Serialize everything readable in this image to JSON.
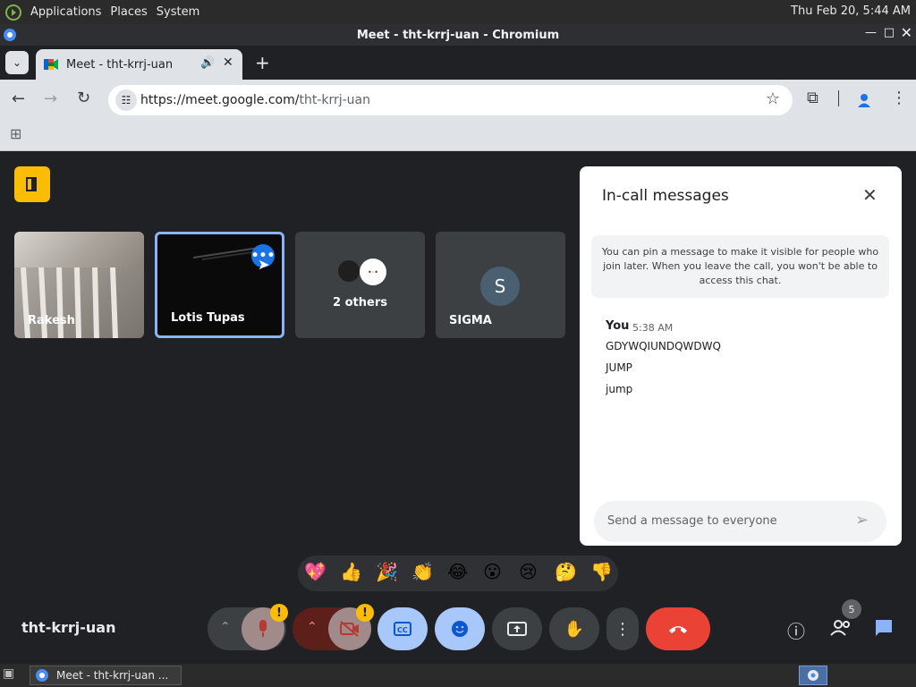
{
  "system_panel": {
    "menus": [
      "Applications",
      "Places",
      "System"
    ],
    "clock": "Thu Feb 20,  5:44 AM"
  },
  "window": {
    "title": "Meet - tht-krrj-uan - Chromium"
  },
  "tab": {
    "title": "Meet - tht-krrj-uan"
  },
  "toolbar": {
    "url_host": "https://meet.google.com/",
    "url_path": "tht-krrj-uan"
  },
  "meet": {
    "meeting_code": "tht-krrj-uan",
    "participants": [
      {
        "name": "Rakesh"
      },
      {
        "name": "Lotis Tupas"
      },
      {
        "name": "2 others"
      },
      {
        "name": "SIGMA",
        "initial": "S"
      }
    ],
    "people_count": "5",
    "reactions": [
      "💖",
      "👍",
      "🎉",
      "👏",
      "😂",
      "😮",
      "😢",
      "🤔",
      "👎"
    ],
    "alert_glyph": "!"
  },
  "chat": {
    "title": "In-call messages",
    "info": "You can pin a message to make it visible for people who join later. When you leave the call, you won't be able to access this chat.",
    "sender": "You",
    "time": "5:38 AM",
    "messages": [
      "GDYWQIUNDQWDWQ",
      "JUMP",
      "jump"
    ],
    "input_placeholder": "Send a message to everyone"
  },
  "taskbar": {
    "window_label": "Meet - tht-krrj-uan ..."
  },
  "colors": {
    "accent_blue": "#8ab4f8",
    "end_call_red": "#ea4335",
    "meet_yellow": "#fbbc04"
  }
}
